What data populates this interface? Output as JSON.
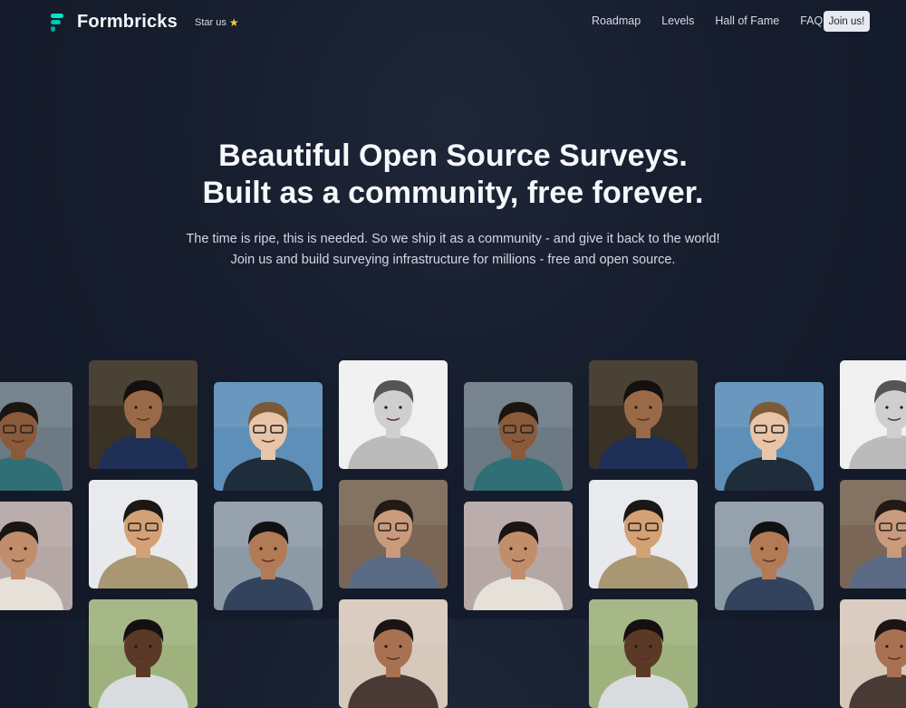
{
  "nav": {
    "brand": "Formbricks",
    "star": "Star us",
    "links": [
      "Roadmap",
      "Levels",
      "Hall of Fame",
      "FAQ"
    ],
    "join": "Join us!"
  },
  "hero": {
    "title_line1": "Beautiful Open Source Surveys.",
    "title_line2": "Built as a community, free forever.",
    "sub_line1": "The time is ripe, this is needed. So we ship it as a community - and give it back to the world!",
    "sub_line2": "Join us and build surveying infrastructure for millions - free and open source."
  },
  "colors": {
    "brand_teal": "#00c4b8",
    "background": "#161d2d",
    "button_bg": "#e6e9ef"
  },
  "avatars": [
    "community-avatar"
  ]
}
